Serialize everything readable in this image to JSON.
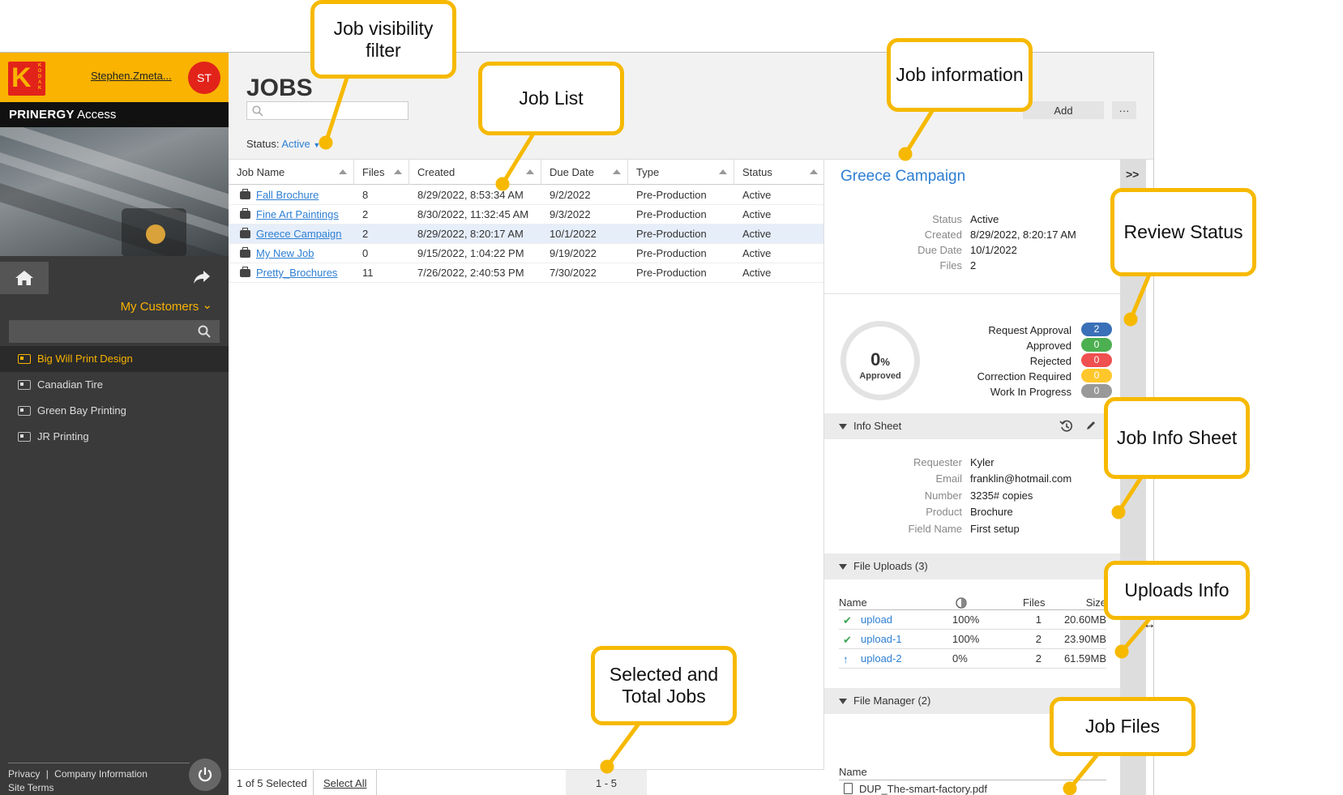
{
  "sidebar": {
    "user_name": "Stephen.Zmeta...",
    "user_initials": "ST",
    "brand_bold": "PRINERGY",
    "brand_rest": " Access",
    "customers_label": "My Customers",
    "customers": [
      {
        "name": "Big Will Print Design",
        "selected": true
      },
      {
        "name": "Canadian Tire",
        "selected": false
      },
      {
        "name": "Green Bay Printing",
        "selected": false
      },
      {
        "name": "JR Printing",
        "selected": false
      }
    ],
    "footer": {
      "privacy": "Privacy",
      "separator": "|",
      "company": "Company Information",
      "terms": "Site Terms"
    }
  },
  "main": {
    "title": "JOBS",
    "add_label": "Add",
    "more_label": "···",
    "status_label": "Status:",
    "status_value": "Active",
    "columns": [
      "Job Name",
      "Files",
      "Created",
      "Due Date",
      "Type",
      "Status"
    ],
    "jobs": [
      {
        "name": "Fall Brochure",
        "files": "8",
        "created": "8/29/2022, 8:53:34 AM",
        "due": "9/2/2022",
        "type": "Pre-Production",
        "status": "Active"
      },
      {
        "name": "Fine Art Paintings",
        "files": "2",
        "created": "8/30/2022, 11:32:45 AM",
        "due": "9/3/2022",
        "type": "Pre-Production",
        "status": "Active"
      },
      {
        "name": "Greece Campaign",
        "files": "2",
        "created": "8/29/2022, 8:20:17 AM",
        "due": "10/1/2022",
        "type": "Pre-Production",
        "status": "Active"
      },
      {
        "name": "My New Job",
        "files": "0",
        "created": "9/15/2022, 1:04:22 PM",
        "due": "9/19/2022",
        "type": "Pre-Production",
        "status": "Active"
      },
      {
        "name": "Pretty_Brochures",
        "files": "11",
        "created": "7/26/2022, 2:40:53 PM",
        "due": "7/30/2022",
        "type": "Pre-Production",
        "status": "Active"
      }
    ],
    "footer": {
      "selected_text": "1 of 5 Selected",
      "select_all": "Select All",
      "range": "1 - 5"
    }
  },
  "panel": {
    "job_title": "Greece Campaign",
    "collapse_label": ">>",
    "info": [
      {
        "key": "Status",
        "value": "Active"
      },
      {
        "key": "Created",
        "value": "8/29/2022, 8:20:17 AM"
      },
      {
        "key": "Due Date",
        "value": "10/1/2022"
      },
      {
        "key": "Files",
        "value": "2"
      }
    ],
    "donut": {
      "percent": "0",
      "percent_sign": "%",
      "label": "Approved"
    },
    "review_status": [
      {
        "name": "Request Approval",
        "count": "2",
        "color": "#3a70b8"
      },
      {
        "name": "Approved",
        "count": "0",
        "color": "#4caf50"
      },
      {
        "name": "Rejected",
        "count": "0",
        "color": "#f05050"
      },
      {
        "name": "Correction Required",
        "count": "0",
        "color": "#ffc72c"
      },
      {
        "name": "Work In Progress",
        "count": "0",
        "color": "#999999"
      }
    ],
    "info_sheet": {
      "title": "Info Sheet",
      "fields": [
        {
          "key": "Requester",
          "value": "Kyler"
        },
        {
          "key": "Email",
          "value": "franklin@hotmail.com"
        },
        {
          "key": "Number",
          "value": "3235# copies"
        },
        {
          "key": "Product",
          "value": "Brochure"
        },
        {
          "key": "Field Name",
          "value": "First setup"
        }
      ]
    },
    "file_uploads": {
      "title": "File Uploads (3)",
      "col_name": "Name",
      "col_files": "Files",
      "col_size": "Size",
      "rows": [
        {
          "name": "upload",
          "percent": "100%",
          "files": "1",
          "size": "20.60MB",
          "state": "done"
        },
        {
          "name": "upload-1",
          "percent": "100%",
          "files": "2",
          "size": "23.90MB",
          "state": "done"
        },
        {
          "name": "upload-2",
          "percent": "0%",
          "files": "2",
          "size": "61.59MB",
          "state": "uploading"
        }
      ]
    },
    "file_manager": {
      "title": "File Manager (2)",
      "col_name": "Name",
      "files": [
        "DUP_The-smart-factory.pdf"
      ]
    }
  },
  "callouts": {
    "visibility": "Job visibility filter",
    "job_list": "Job List",
    "job_info": "Job information",
    "review": "Review Status",
    "info_sheet": "Job Info Sheet",
    "uploads": "Uploads Info",
    "selected_total": "Selected and Total Jobs",
    "job_files": "Job Files"
  },
  "colors": {
    "kodak_yellow": "#f9b300",
    "kodak_red": "#e2231a",
    "link_blue": "#2d7fd3",
    "callout_border": "#f6b900",
    "sidebar_bg": "#3a3a3a"
  }
}
